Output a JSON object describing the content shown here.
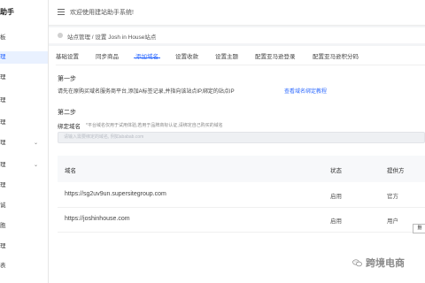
{
  "sidebar": {
    "brand": "助手",
    "items": [
      {
        "label": "板"
      },
      {
        "label": "理"
      },
      {
        "label": "理"
      },
      {
        "label": "理"
      },
      {
        "label": "理"
      },
      {
        "label": "理"
      },
      {
        "label": "理"
      },
      {
        "label": "理"
      },
      {
        "label": "诚"
      },
      {
        "label": "胞"
      },
      {
        "label": "理"
      },
      {
        "label": "表"
      }
    ]
  },
  "header": {
    "welcome": "欢迎使用建站助手系统!"
  },
  "breadcrumb": {
    "text": "站点管理 / 设置 Josh in House站点"
  },
  "tabs": [
    {
      "label": "基础设置"
    },
    {
      "label": "同步商品"
    },
    {
      "label": "添加域名"
    },
    {
      "label": "设置收款"
    },
    {
      "label": "设置主题"
    },
    {
      "label": "配置亚马逊登录"
    },
    {
      "label": "配置亚马逊积分码"
    }
  ],
  "step1": {
    "title": "第一步",
    "description": "请先在原购买域名服务商平台,添加A标签记录,并指向该站点IP,绑定的站点IP",
    "link": "查看域名绑定教程"
  },
  "step2": {
    "title": "第二步",
    "bind_label": "绑定域名",
    "bind_hint": "*平台域名仅用于试用体验,若用于品牌商标认证,请绑定自己购买的域名",
    "input_placeholder": "请输入需要绑定的域名, 例如ababab.com"
  },
  "table": {
    "columns": [
      "域名",
      "状态",
      "提供方"
    ],
    "rows": [
      {
        "domain": "https://sg2uv9un.supersitegroup.com",
        "status": "启用",
        "provider": "官方"
      },
      {
        "domain": "https://joshinhouse.com",
        "status": "启用",
        "provider": "用户"
      }
    ]
  },
  "edge_button": "删",
  "watermark": {
    "text": "跨境电商",
    "icon": "wechat-icon"
  },
  "colors": {
    "accent": "#2f6bff",
    "page_bg": "#f3f4f6"
  }
}
